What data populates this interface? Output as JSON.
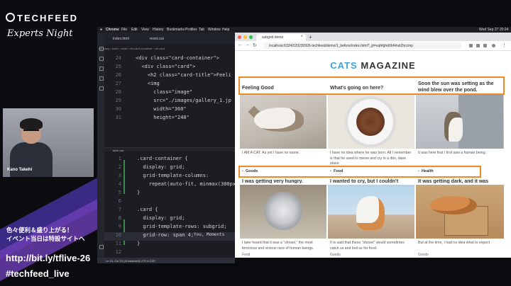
{
  "overlay": {
    "brand": "TECHFEED",
    "event_title": "Experts Night",
    "speaker_name": "Kano Takehi",
    "promo_line1": "色々便利＆盛り上がる！",
    "promo_line2": "イベント当日は特設サイトへ",
    "promo_link": "http://bit.ly/tflive-26",
    "hashtag": "#techfeed_live"
  },
  "menubar": {
    "app": "Chrome",
    "items": [
      "File",
      "Edit",
      "View",
      "History",
      "Bookmarks",
      "Profiles",
      "Tab",
      "Window",
      "Help"
    ],
    "clock": "Wed Sep 27  20:24"
  },
  "editor": {
    "tabs": [
      "index.html",
      "reset.css"
    ],
    "breadcrumb": "cat-story › index › main › div.card-container › div.card",
    "style_tab": "style.css",
    "top_lines": [
      {
        "n": "24",
        "code": "<div class=\"card-container\">"
      },
      {
        "n": "25",
        "code": "  <div class=\"card\">"
      },
      {
        "n": "26",
        "code": "    <h2 class=\"card-title\">Feeli"
      },
      {
        "n": "27",
        "code": "    <img"
      },
      {
        "n": "28",
        "code": "      class=\"image\""
      },
      {
        "n": "29",
        "code": "      src=\"./images/gallery_1.jp"
      },
      {
        "n": "30",
        "code": "      width=\"360\""
      },
      {
        "n": "31",
        "code": "      height=\"240\""
      }
    ],
    "bottom_lines": [
      {
        "n": "1",
        "code": ".card-container {"
      },
      {
        "n": "2",
        "code": "  display: grid;"
      },
      {
        "n": "3",
        "code": "  grid-template-columns:"
      },
      {
        "n": "4",
        "code": "    repeat(auto-fit, minmax(300px,"
      },
      {
        "n": "5",
        "code": "}"
      },
      {
        "n": "6",
        "code": ""
      },
      {
        "n": "7",
        "code": ".card {"
      },
      {
        "n": "8",
        "code": "  display: grid;"
      },
      {
        "n": "9",
        "code": "  grid-template-rows: subgrid;"
      },
      {
        "n": "10",
        "code": "  grid-row: span 4;"
      },
      {
        "n": "11",
        "code": "}"
      },
      {
        "n": "12",
        "code": ""
      },
      {
        "n": "13",
        "code": "/* その他のスタイル */"
      },
      {
        "n": "14",
        "code": ""
      },
      {
        "n": "15",
        "code": ":root {"
      }
    ],
    "ghost_text": "You, Moments",
    "status": "Ln 10, Col 20 (18 selected)   UTF-8   CSS"
  },
  "browser": {
    "tab_title": "subgrid demo",
    "url": "localhost:63342/20230926-techfeed/demo/1_before/index.html?_ijt=uqhfghdr9d4nst2hccmp",
    "magazine_brand": "CATS",
    "magazine_word": "MAGAZINE",
    "cards_row1": [
      {
        "title": "Feeling Good",
        "caption": "I AM A CAT. As yet I have no name.",
        "tag": "Goods"
      },
      {
        "title": "What's going on here?",
        "caption": "I have no idea where he was born. All I remember is that he used to meow and cry in a dim, dank place.",
        "tag": "Food"
      },
      {
        "title": "Soon the sun was setting as the wind blew over the pond.",
        "caption": "It was here that I first saw a human being.",
        "tag": "Health"
      }
    ],
    "cards_row2": [
      {
        "title": "I was getting very hungry.",
        "caption": "I later heard that it was a \"shosei,\" the most ferocious and vicious race of human beings.",
        "tag": "Food"
      },
      {
        "title": "I wanted to cry, but I couldn't speak.",
        "caption": "It is said that these \"shosei\" would sometimes catch us and boil us for food.",
        "tag": "Goods"
      },
      {
        "title": "It was getting dark, and it was raining.",
        "caption": "But at the time, I had no idea what to expect.",
        "tag": "Goods"
      }
    ]
  }
}
